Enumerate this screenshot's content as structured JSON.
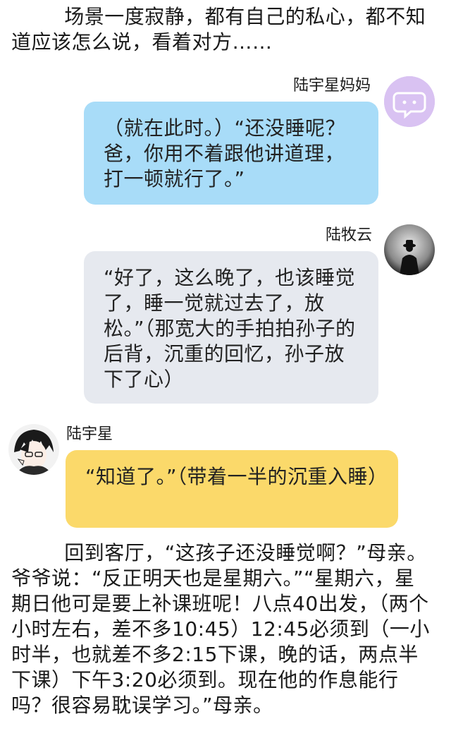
{
  "narration_top": "        场景一度寂静，都有自己的私心，都不知道应该怎么说，看着对方……",
  "messages": [
    {
      "speaker": "陆宇星妈妈",
      "text": "（就在此时。）“还没睡呢？爸，你用不着跟他讲道理，打一顿就行了。”",
      "bubble_color": "#a8dcf8",
      "avatar_icon": "chat-bubble-face-icon",
      "avatar_color": "#d9c2f2"
    },
    {
      "speaker": "陆牧云",
      "text": "“好了，这么晚了，也该睡觉了，睡一觉就过去了，放松。”（那宽大的手拍拍孙子的后背，沉重的回忆，孙子放下了心）",
      "bubble_color": "#e6e9ef",
      "avatar_icon": "man-in-hat-silhouette-icon"
    },
    {
      "speaker": "陆宇星",
      "text": "“知道了。”（带着一半的沉重入睡）",
      "bubble_color": "#fbd96a",
      "avatar_icon": "anime-boy-portrait-icon"
    }
  ],
  "narration_bottom": "        回到客厅，“这孩子还没睡觉啊？”母亲。爷爷说：“反正明天也是星期六。”“星期六，星期日他可是要上补课班呢！八点40出发，（两个小时左右，差不多10:45）12:45必须到（一小时半，也就差不多2:15下课，晚的话，两点半下课）下午3:20必须到。现在他的作息能行吗？很容易耽误学习。”母亲。"
}
